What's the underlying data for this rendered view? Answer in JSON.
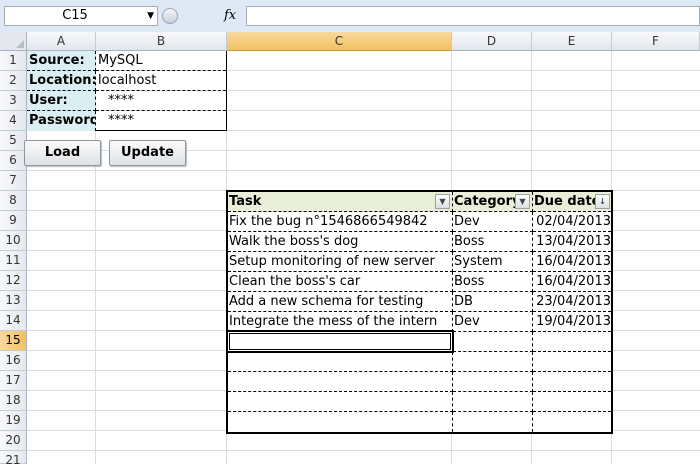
{
  "formula_bar": {
    "name_box": "C15",
    "fx_label": "fx",
    "formula": ""
  },
  "columns": [
    "A",
    "B",
    "C",
    "D",
    "E",
    "F"
  ],
  "rows": [
    "1",
    "2",
    "3",
    "4",
    "5",
    "6",
    "7",
    "8",
    "9",
    "10",
    "11",
    "12",
    "13",
    "14",
    "15",
    "16",
    "17",
    "18",
    "19",
    "20",
    "21"
  ],
  "selected": {
    "column": "C",
    "row": "15"
  },
  "connection": {
    "source_label": "Source:",
    "source_value": "MySQL",
    "location_label": "Location:",
    "location_value": "localhost",
    "user_label": "User:",
    "user_value": "****",
    "password_label": "Password:",
    "password_value": "****"
  },
  "buttons": {
    "load": "Load",
    "update": "Update"
  },
  "table": {
    "headers": [
      "Task",
      "Category",
      "Due date"
    ],
    "rows": [
      [
        "Fix the bug n°1546866549842",
        "Dev",
        "02/04/2013"
      ],
      [
        "Walk the boss's dog",
        "Boss",
        "13/04/2013"
      ],
      [
        "Setup monitoring of new server",
        "System",
        "16/04/2013"
      ],
      [
        "Clean the boss's car",
        "Boss",
        "16/04/2013"
      ],
      [
        "Add a new schema for testing",
        "DB",
        "23/04/2013"
      ],
      [
        "Integrate the mess of the intern",
        "Dev",
        "19/04/2013"
      ]
    ]
  },
  "colors": {
    "label_fill": "#dbeef4",
    "header_fill": "#e8eed7",
    "selection": "#f1c15f"
  }
}
